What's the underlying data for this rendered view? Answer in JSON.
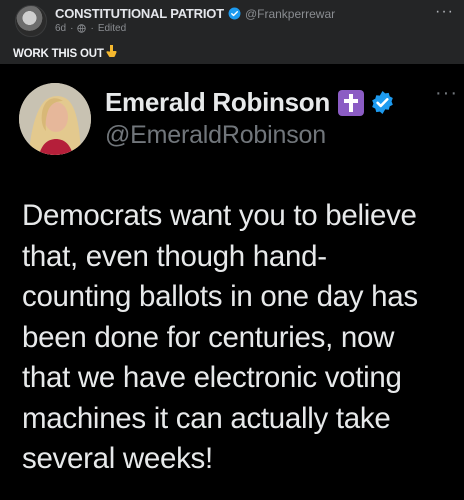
{
  "post": {
    "author": "CONSTITUTIONAL PATRIOT",
    "handle": "@Frankperrewar",
    "age": "6d",
    "separator": "·",
    "edited": "Edited",
    "more": "···",
    "caption": "WORK THIS OUT",
    "caption_emoji": "pointing-down-emoji"
  },
  "tweet": {
    "name": "Emerald Robinson",
    "handle": "@EmeraldRobinson",
    "more": "···",
    "badges": [
      "cross-icon",
      "verified-icon"
    ],
    "lines": [
      "Democrats want you to believe",
      "that, even though hand-",
      "counting ballots in one day has",
      "been done for centuries, now",
      "that we have electronic voting",
      "machines it can actually take",
      "several weeks!"
    ]
  },
  "colors": {
    "page_bg": "#242526",
    "tweet_bg": "#000000",
    "verified_blue": "#1d9bf0",
    "cross_badge": "#8b5cc4"
  }
}
